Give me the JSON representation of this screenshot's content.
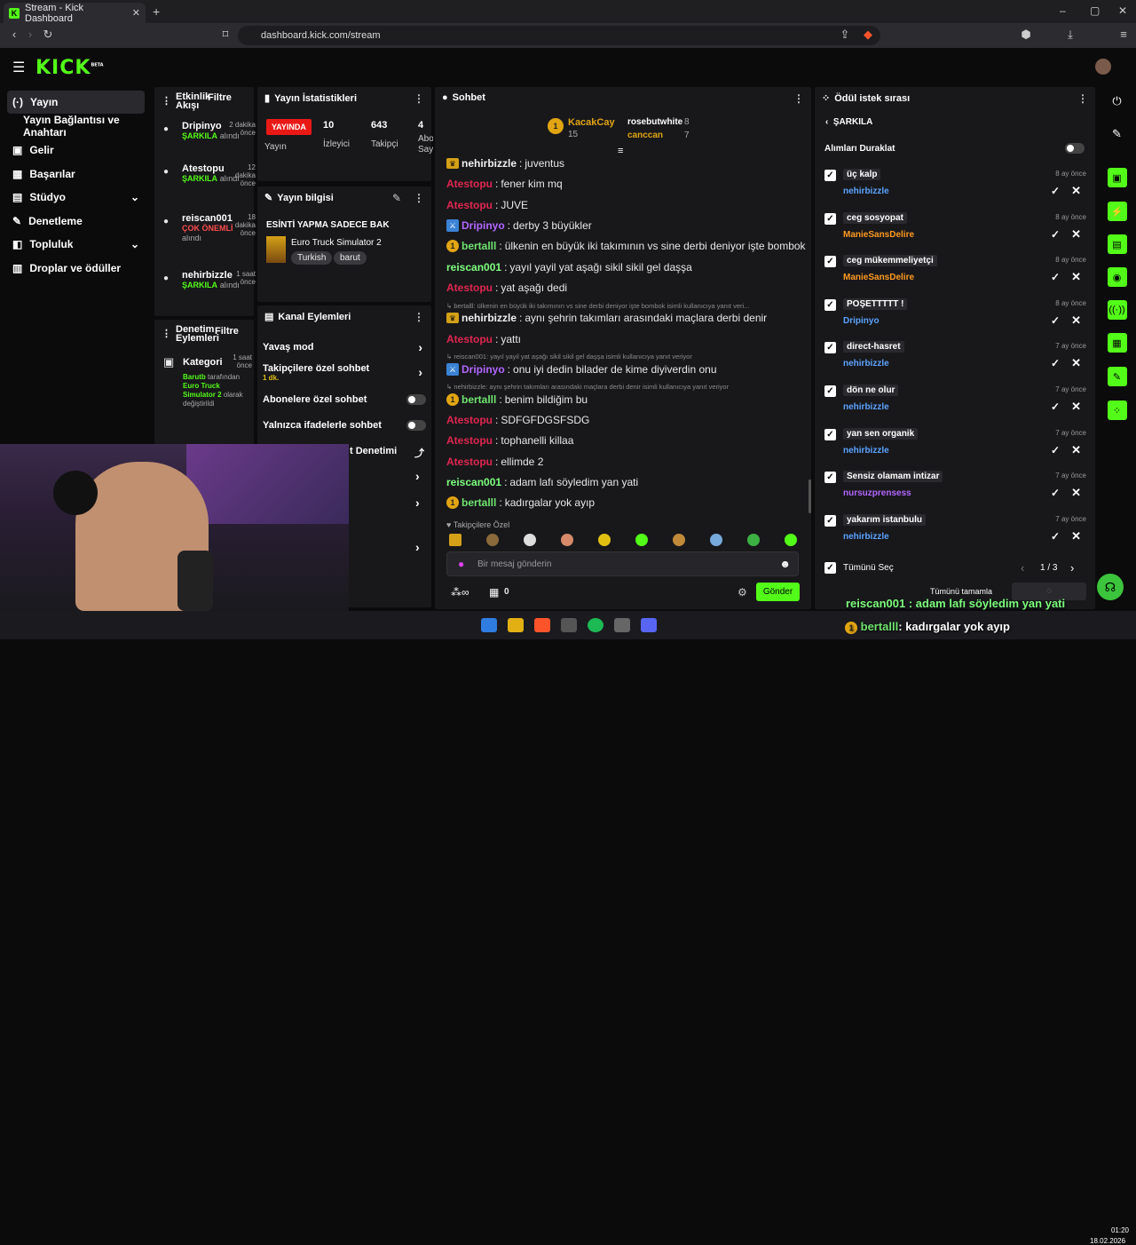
{
  "browser": {
    "tab_title": "Stream - Kick Dashboard",
    "url": "dashboard.kick.com/stream"
  },
  "brand": {
    "logo": "KICK",
    "logo_sup": "BETA",
    "accent": "#53fc18"
  },
  "sidebar": {
    "items": [
      {
        "label": "Yayın",
        "icon": "broadcast-icon"
      },
      {
        "label": "Yayın Bağlantısı ve Anahtarı"
      },
      {
        "label": "Gelir",
        "icon": "money-icon"
      },
      {
        "label": "Başarılar",
        "icon": "trophy-icon"
      },
      {
        "label": "Stüdyo",
        "icon": "studio-icon"
      },
      {
        "label": "Denetleme",
        "icon": "wrench-icon"
      },
      {
        "label": "Topluluk",
        "icon": "community-icon"
      },
      {
        "label": "Droplar ve ödüller",
        "icon": "gift-icon"
      }
    ]
  },
  "activity": {
    "title": "Etkinlik Akışı",
    "filter": "Filtre",
    "items": [
      {
        "user": "Dripinyo",
        "time": "2 dakika önce",
        "action": "ŞARKILA",
        "suffix": "alındı"
      },
      {
        "user": "Atestopu",
        "time": "12 dakika önce",
        "action": "ŞARKILA",
        "suffix": "alındı"
      },
      {
        "user": "reiscan001",
        "time": "18 dakika önce",
        "action": "ÇOK ÖNEMLİ",
        "suffix": "alındı"
      },
      {
        "user": "nehirbizzle",
        "time": "1 saat önce",
        "action": "ŞARKILA",
        "suffix": "alındı"
      }
    ]
  },
  "moderation": {
    "title": "Denetim Eylemleri",
    "filter": "Filtre",
    "item": {
      "label": "Kategori",
      "time": "1 saat önce",
      "user": "Barutb",
      "line1": "tarafından",
      "category": "Euro Truck Simulator 2",
      "line2": "olarak değiştirildi"
    }
  },
  "stats": {
    "title": "Yayın İstatistikleri",
    "live": "YAYINDA",
    "live_label": "Yayın",
    "viewers": "10",
    "viewers_label": "İzleyici",
    "followers": "643",
    "followers_label": "Takipçi",
    "subs": "4",
    "subs_label": "Abo Say"
  },
  "stream_info": {
    "title": "Yayın bilgisi",
    "stream_title": "ESİNTİ YAPMA SADECE BAK",
    "game": "Euro Truck Simulator 2",
    "tags": [
      "Turkish",
      "barut"
    ]
  },
  "channel_actions": {
    "title": "Kanal Eylemleri",
    "items": [
      {
        "label": "Yavaş mod"
      },
      {
        "label": "Takipçilere özel sohbet",
        "sub": "1 dk."
      },
      {
        "label": "Abonelere özel sohbet"
      },
      {
        "label": "Yalnızca ifadelerle sohbet"
      },
      {
        "label": "t Denetimi"
      }
    ]
  },
  "chat": {
    "title": "Sohbet",
    "top_gifters": [
      {
        "name": "KacakCay",
        "count": "15"
      },
      {
        "name": "rosebutwhite",
        "count": "8"
      },
      {
        "name": "canccan",
        "count": "7"
      }
    ],
    "messages": [
      {
        "user": "nehirbizzle",
        "text": "juventus",
        "color": "#f0f0f0"
      },
      {
        "user": "Atestopu",
        "text": "fener kim mq",
        "color": "#e0264f"
      },
      {
        "user": "Atestopu",
        "text": "JUVE",
        "color": "#e0264f"
      },
      {
        "user": "Dripinyo",
        "text": "derby 3 büyükler",
        "color": "#b366ff"
      },
      {
        "user": "bertalll",
        "text": "ülkenin en büyük iki takımının vs sine derbi deniyor işte bombok",
        "color": "#6fe46f"
      },
      {
        "user": "reiscan001",
        "text": "yayıl yayil yat aşağı sikil sikil gel daşşa",
        "color": "#7dff7d"
      },
      {
        "user": "Atestopu",
        "text": "yat aşağı dedi",
        "color": "#e0264f"
      },
      {
        "reply": "bertalll: ülkenin en büyük iki takımının vs sine derbi deniyor işte bombok isimli kullanıcıya yanıt veri..."
      },
      {
        "user": "nehirbizzle",
        "text": "aynı şehrin takımları arasındaki maçlara derbi denir",
        "color": "#f0f0f0"
      },
      {
        "user": "Atestopu",
        "text": "yattı",
        "color": "#e0264f"
      },
      {
        "reply": "reiscan001: yayıl yayil yat aşağı sikil sikil gel daşşa isimli kullanıcıya yanıt veriyor"
      },
      {
        "user": "Dripinyo",
        "text": "onu iyi dedin bilader de kime diyiverdin onu",
        "color": "#b366ff"
      },
      {
        "reply": "nehirbizzle: aynı şehrin takımları arasındaki maçlara derbi denir isimli kullanıcıya yanıt veriyor"
      },
      {
        "user": "bertalll",
        "text": "benim bildiğim bu",
        "color": "#6fe46f"
      },
      {
        "user": "Atestopu",
        "text": "SDFGFDGSFSDG",
        "color": "#e0264f"
      },
      {
        "user": "Atestopu",
        "text": "tophanelli killaa",
        "color": "#e0264f"
      },
      {
        "user": "Atestopu",
        "text": "ellimde 2",
        "color": "#e0264f"
      },
      {
        "user": "reiscan001",
        "text": "adam lafı söyledim yan yati",
        "color": "#7dff7d"
      },
      {
        "user": "bertalll",
        "text": "kadırgalar yok ayıp",
        "color": "#6fe46f"
      }
    ],
    "followers_only": "Takipçilere Özel",
    "placeholder": "Bir mesaj gönderin",
    "points": "0",
    "send": "Gönder"
  },
  "rewards": {
    "title": "Ödül istek sırası",
    "back": "ŞARKILA",
    "pause": "Alımları Duraklat",
    "items": [
      {
        "title": "üç kalp",
        "user": "nehirbizzle",
        "time": "8 ay önce",
        "color": "#5ba3ff"
      },
      {
        "title": "ceg sosyopat",
        "user": "ManieSansDelire",
        "time": "8 ay önce",
        "color": "#ff9a1f"
      },
      {
        "title": "ceg mükemmeliyetçi",
        "user": "ManieSansDelire",
        "time": "8 ay önce",
        "color": "#ff9a1f"
      },
      {
        "title": "POŞETTTTT !",
        "user": "Dripinyo",
        "time": "8 ay önce",
        "color": "#5ba3ff"
      },
      {
        "title": "direct-hasret",
        "user": "nehirbizzle",
        "time": "7 ay önce",
        "color": "#5ba3ff"
      },
      {
        "title": "dön ne olur",
        "user": "nehirbizzle",
        "time": "7 ay önce",
        "color": "#5ba3ff"
      },
      {
        "title": "yan sen organik",
        "user": "nehirbizzle",
        "time": "7 ay önce",
        "color": "#5ba3ff"
      },
      {
        "title": "Sensiz olamam intizar",
        "user": "nursuzprensess",
        "time": "7 ay önce",
        "color": "#b366ff"
      },
      {
        "title": "yakarım istanbulu",
        "user": "nehirbizzle",
        "time": "7 ay önce",
        "color": "#5ba3ff"
      }
    ],
    "select_all": "Tümünü Seç",
    "page": "1 / 3",
    "complete_all": "Tümünü tamamla"
  },
  "overlay": {
    "line1": "reiscan001 : adam lafı söyledim yan yati",
    "line2_user": "bertalll",
    "line2_text": ": kadırgalar yok ayıp"
  },
  "taskbar": {
    "time": "01:20",
    "date": "18.02.2026"
  }
}
